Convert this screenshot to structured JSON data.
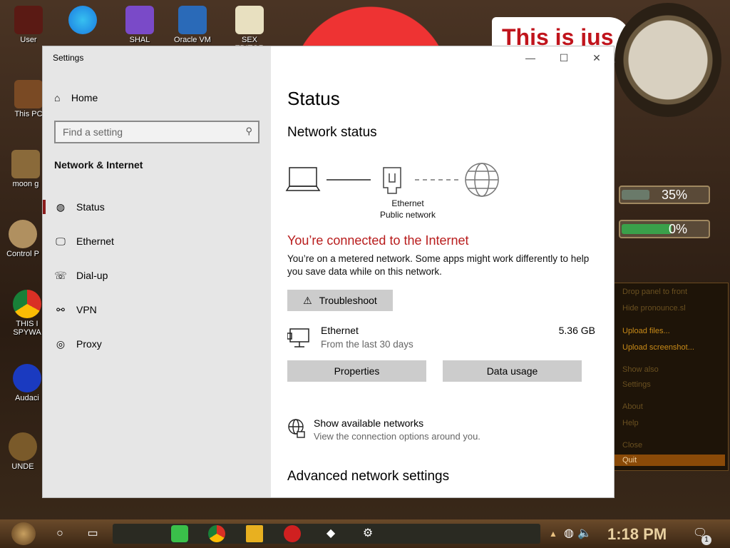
{
  "desktop": {
    "icons": [
      {
        "label": "User"
      },
      {
        "label": "This PC"
      },
      {
        "label": "moon g"
      },
      {
        "label": "Control P"
      },
      {
        "label": "THIS I SPYWA"
      },
      {
        "label": "Audaci"
      },
      {
        "label": "UNDE"
      },
      {
        "label": "SHAL"
      },
      {
        "label": "Oracle VM"
      },
      {
        "label": "SEX EDITOR"
      }
    ],
    "banner_text": "This is jus",
    "gauges": [
      {
        "label": "35%",
        "level": 0.55,
        "color": "#6a7a6a"
      },
      {
        "label": "0%",
        "level": 1.0,
        "color": "#3aa04a"
      }
    ],
    "context_menu": {
      "items": [
        {
          "label": "Drop panel to front"
        },
        {
          "label": "Hide pronounce.sl"
        },
        {
          "label": "Upload files..."
        },
        {
          "label": "Upload screenshot..."
        },
        {
          "label": "Show also"
        },
        {
          "label": "Settings"
        },
        {
          "label": "About"
        },
        {
          "label": "Help"
        },
        {
          "label": "Close"
        },
        {
          "label": "Quit"
        }
      ]
    }
  },
  "window": {
    "app_title": "Settings",
    "controls": {
      "minimize": "—",
      "maximize": "☐",
      "close": "✕"
    },
    "nav": {
      "home_icon": "⌂",
      "home": "Home",
      "search_placeholder": "Find a setting",
      "search_icon": "⚲",
      "section": "Network & Internet",
      "items": [
        {
          "label": "Status",
          "icon": "globe-icon",
          "glyph": "◍"
        },
        {
          "label": "Ethernet",
          "icon": "ethernet-icon",
          "glyph": "🖵"
        },
        {
          "label": "Dial-up",
          "icon": "dialup-icon",
          "glyph": "☏"
        },
        {
          "label": "VPN",
          "icon": "vpn-icon",
          "glyph": "⚯"
        },
        {
          "label": "Proxy",
          "icon": "proxy-icon",
          "glyph": "◎"
        }
      ]
    },
    "main": {
      "title": "Status",
      "network_status": "Network status",
      "diagram_label_1": "Ethernet",
      "diagram_label_2": "Public network",
      "connected_msg": "You’re connected to the Internet",
      "metered_msg": "You’re on a metered network. Some apps might work differently to help you save data while on this network.",
      "troubleshoot_icon": "⚠",
      "troubleshoot": "Troubleshoot",
      "ethernet_name": "Ethernet",
      "ethernet_sub": "From the last 30 days",
      "ethernet_size": "5.36 GB",
      "properties": "Properties",
      "data_usage": "Data usage",
      "available_title": "Show available networks",
      "available_sub": "View the connection options around you.",
      "advanced": "Advanced network settings"
    }
  },
  "taskbar": {
    "time": "1:18 PM",
    "notification_count": "1",
    "colors": {
      "accent": "#b81c1c"
    }
  }
}
